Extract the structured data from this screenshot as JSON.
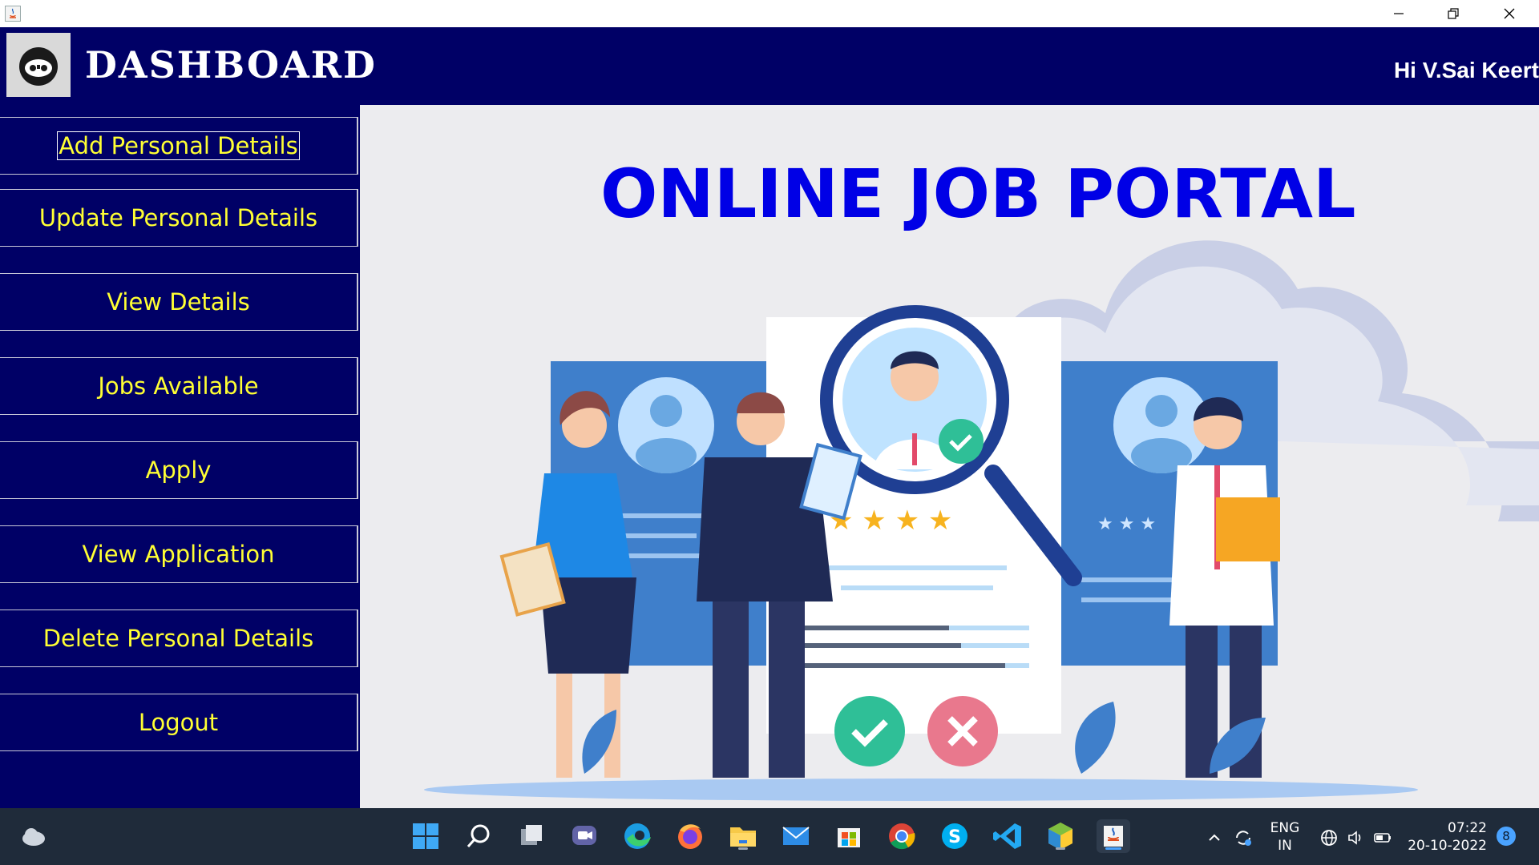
{
  "window": {
    "minimize": "minimize",
    "restore": "restore",
    "close": "close"
  },
  "header": {
    "title": "DASHBOARD",
    "greeting": "Hi V.Sai Keert"
  },
  "sidebar": {
    "items": [
      {
        "label": "Add Personal Details"
      },
      {
        "label": "Update Personal Details"
      },
      {
        "label": "View Details"
      },
      {
        "label": "Jobs Available"
      },
      {
        "label": "Apply"
      },
      {
        "label": "View Application"
      },
      {
        "label": "Delete Personal Details"
      },
      {
        "label": "Logout"
      }
    ]
  },
  "main": {
    "title": "ONLINE JOB PORTAL"
  },
  "taskbar": {
    "language": {
      "line1": "ENG",
      "line2": "IN"
    },
    "clock": {
      "time": "07:22",
      "date": "20-10-2022"
    },
    "notifications": "8"
  },
  "colors": {
    "header_bg": "#000066",
    "menu_text": "#ffff33",
    "title_blue": "#0000e6",
    "main_bg": "#ececef"
  }
}
